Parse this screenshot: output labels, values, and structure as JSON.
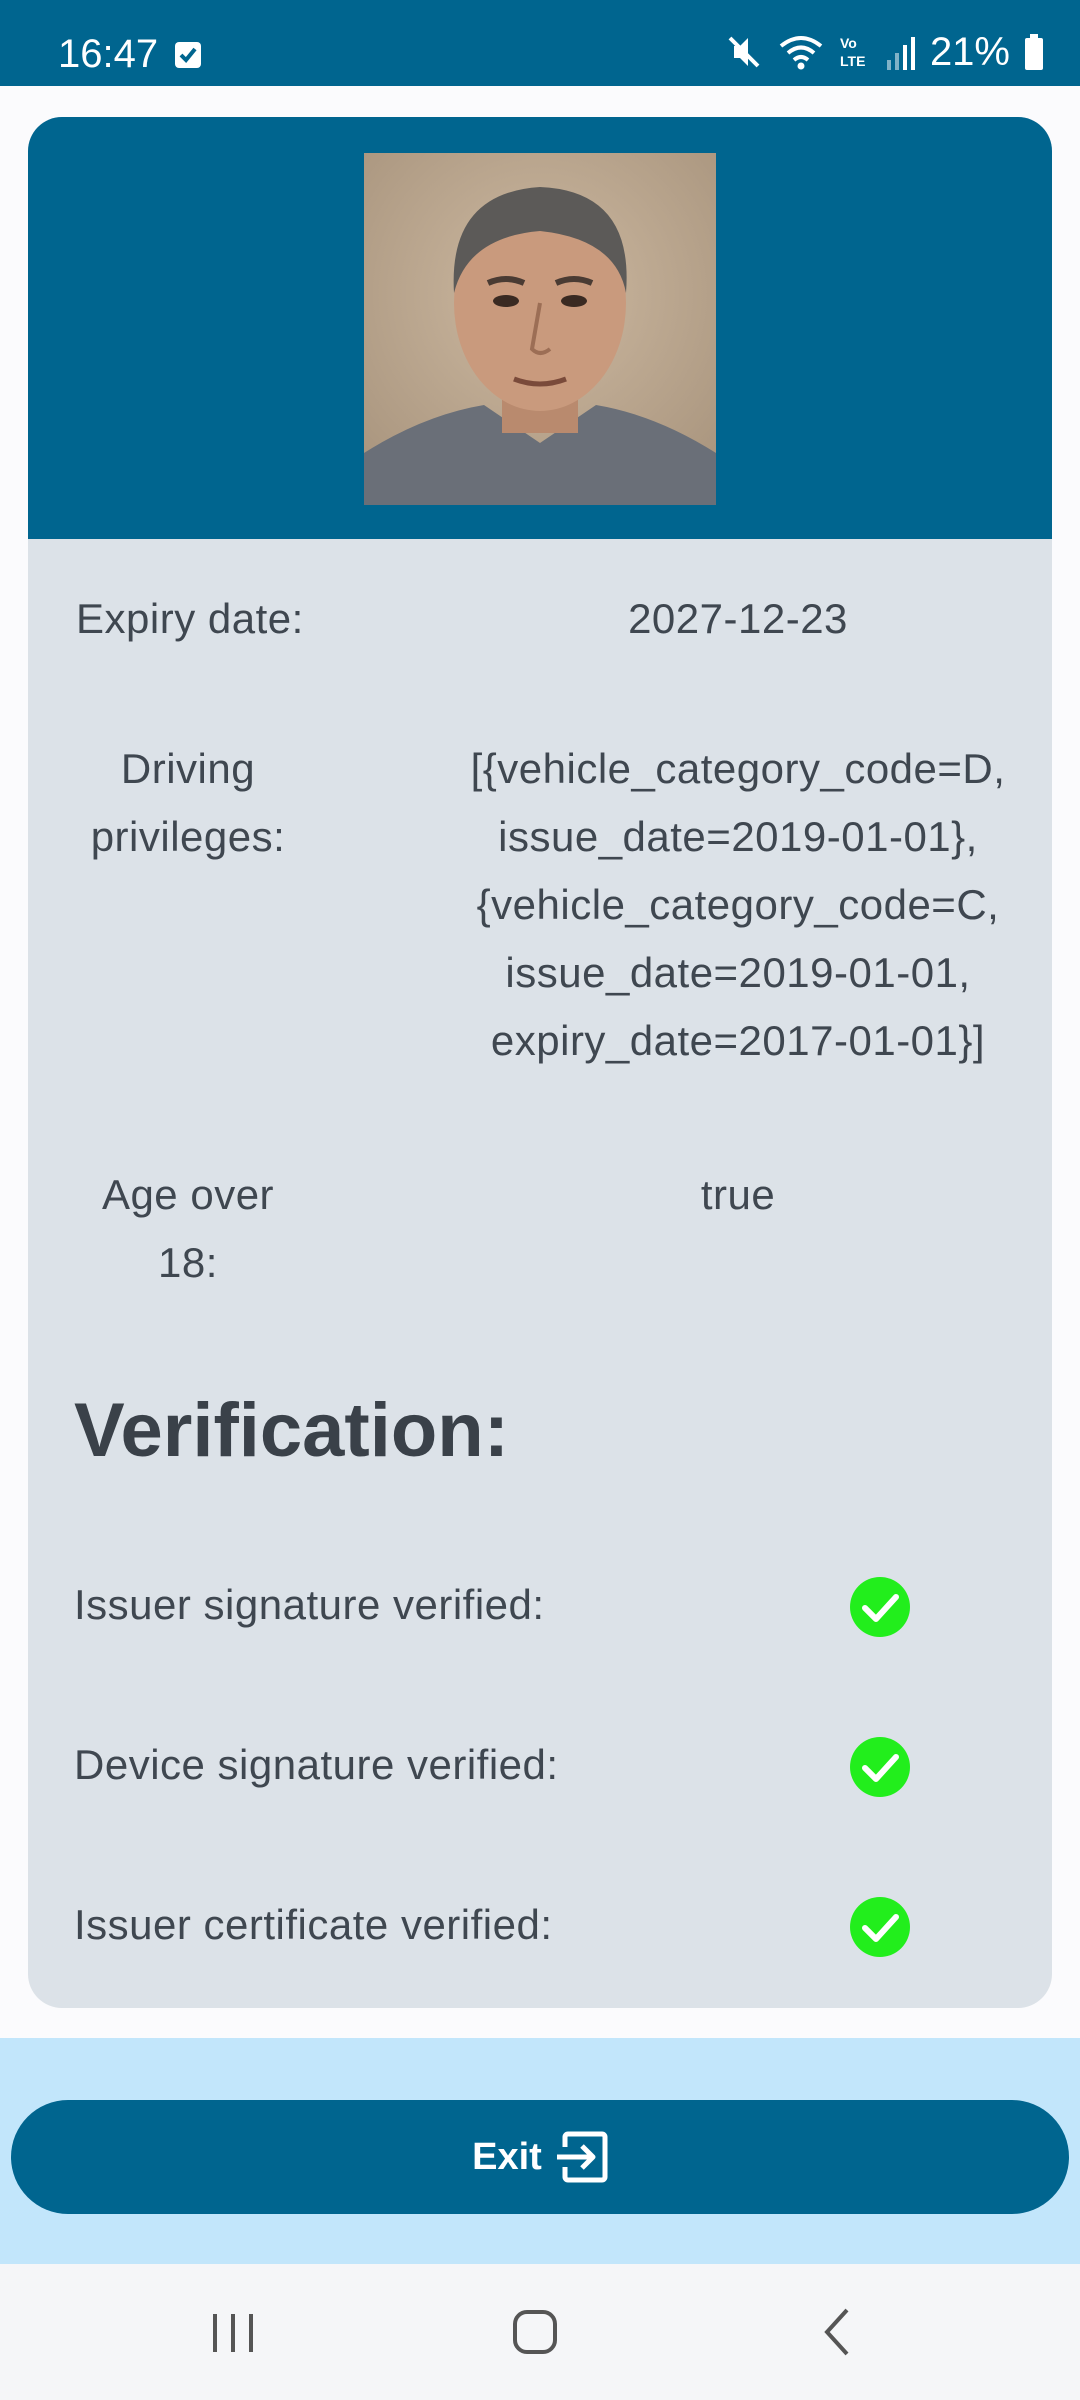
{
  "status_bar": {
    "time": "16:47",
    "battery_percent": "21%",
    "icons": [
      "checkbox-notification-icon",
      "mute-icon",
      "wifi-icon",
      "volte-icon",
      "signal-icon",
      "battery-icon"
    ]
  },
  "photo": {
    "description_icon": "portrait-photo"
  },
  "fields": {
    "expiry_label": "Expiry date:",
    "expiry_value": "2027-12-23",
    "driving_label_line1": "Driving",
    "driving_label_line2": "privileges:",
    "driving_value_lines": [
      "[{vehicle_category_code=D,",
      "issue_date=2019-01-01},",
      "{vehicle_category_code=C,",
      "issue_date=2019-01-01,",
      "expiry_date=2017-01-01}]"
    ],
    "age_label_line1": "Age over",
    "age_label_line2": "18:",
    "age_value": "true"
  },
  "verification": {
    "title": "Verification:",
    "items": [
      {
        "label": "Issuer signature verified:",
        "status": "verified"
      },
      {
        "label": "Device signature verified:",
        "status": "verified"
      },
      {
        "label": "Issuer certificate verified:",
        "status": "verified"
      }
    ]
  },
  "exit_button": {
    "label": "Exit",
    "icon": "exit-icon"
  },
  "colors": {
    "primary": "#00658f",
    "card": "#dce2e8",
    "bottom": "#c2e6fb",
    "check_green": "#22ee1c"
  }
}
